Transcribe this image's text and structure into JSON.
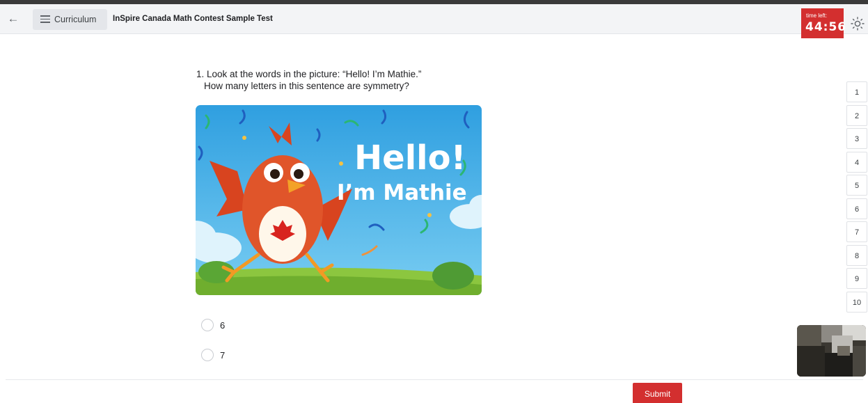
{
  "header": {
    "back_icon": "arrow-left-icon",
    "curriculum_label": "Curriculum",
    "menu_icon": "hamburger-menu-icon",
    "title": "InSpire Canada Math Contest Sample Test",
    "timer_label": "time left:",
    "timer_value": "44:56",
    "theme_icon": "sun-icon"
  },
  "question": {
    "line1": "1. Look at the words in the picture: “Hello! I’m Mathie.”",
    "line2": "How many letters in this sentence are symmetry?",
    "image": {
      "text_line1": "Hello!",
      "text_line2": "I’m Mathie"
    },
    "options": [
      "6",
      "7"
    ]
  },
  "question_nav": [
    "1",
    "2",
    "3",
    "4",
    "5",
    "6",
    "7",
    "8",
    "9",
    "10"
  ],
  "submit_label": "Submit",
  "colors": {
    "accent": "#d32f2f",
    "header_bg": "#f3f4f6",
    "sky": "#45b0e6"
  }
}
